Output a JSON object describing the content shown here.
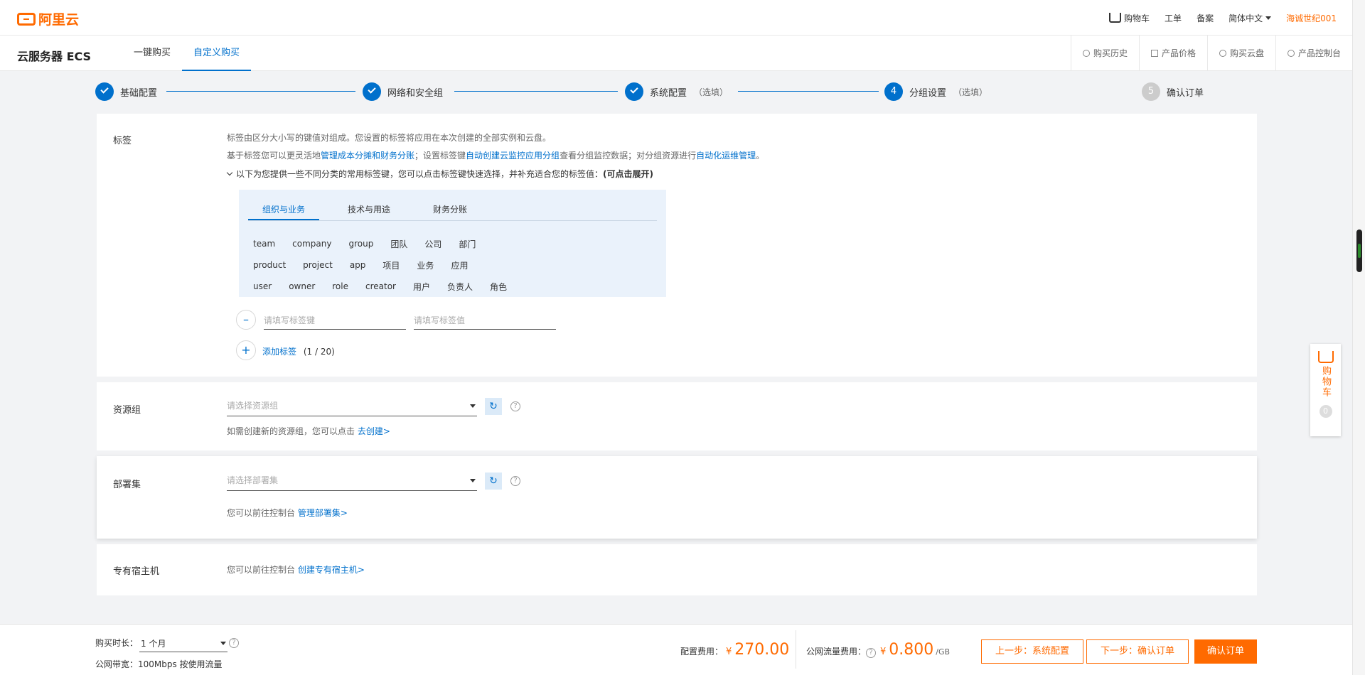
{
  "header": {
    "logo_text": "阿里云",
    "cart_label": "购物车",
    "ticket_label": "工单",
    "record_label": "备案",
    "language_label": "简体中文",
    "username": "海诚世纪001"
  },
  "subnav": {
    "product_title": "云服务器 ECS",
    "tabs": [
      "一键购买",
      "自定义购买"
    ],
    "links": [
      "购买历史",
      "产品价格",
      "购买云盘",
      "产品控制台"
    ]
  },
  "steps": [
    {
      "num": "",
      "label": "基础配置",
      "optional": ""
    },
    {
      "num": "",
      "label": "网络和安全组",
      "optional": ""
    },
    {
      "num": "",
      "label": "系统配置",
      "optional": "（选填）"
    },
    {
      "num": "4",
      "label": "分组设置",
      "optional": "（选填）"
    },
    {
      "num": "5",
      "label": "确认订单",
      "optional": ""
    }
  ],
  "tags": {
    "label": "标签",
    "desc1": "标签由区分大小写的键值对组成。您设置的标签将应用在本次创建的全部实例和云盘。",
    "desc2_prefix": "基于标签您可以更灵活地",
    "desc2_link1": "管理成本分摊和财务分账",
    "desc2_mid": "；设置标签键",
    "desc2_link2": "自动创建云监控应用分组",
    "desc2_mid2": "查看分组监控数据；对分组资源进行",
    "desc2_link3": "自动化运维管理",
    "desc2_end": "。",
    "expand_text": "以下为您提供一些不同分类的常用标签键，您可以点击标签键快速选择，并补充适合您的标签值：",
    "expand_bold": "(可点击展开)",
    "categories": [
      "组织与业务",
      "技术与用途",
      "财务分账"
    ],
    "rows": [
      [
        "team",
        "company",
        "group",
        "团队",
        "公司",
        "部门"
      ],
      [
        "product",
        "project",
        "app",
        "项目",
        "业务",
        "应用"
      ],
      [
        "user",
        "owner",
        "role",
        "creator",
        "用户",
        "负责人",
        "角色"
      ]
    ],
    "key_placeholder": "请填写标签键",
    "value_placeholder": "请填写标签值",
    "add_label": "添加标签",
    "add_count": "(1 / 20)"
  },
  "resource_group": {
    "label": "资源组",
    "placeholder": "请选择资源组",
    "hint": "如需创建新的资源组，您可以点击",
    "link": "去创建>"
  },
  "deploy_set": {
    "label": "部署集",
    "placeholder": "请选择部署集",
    "hint": "您可以前往控制台",
    "link": "管理部署集>"
  },
  "dedicated_host": {
    "label": "专有宿主机",
    "hint": "您可以前往控制台",
    "link": "创建专有宿主机>"
  },
  "footer": {
    "duration_label": "购买时长：",
    "duration_value": "1 个月",
    "bandwidth_text": "公网带宽：100Mbps 按使用流量",
    "config_fee_label": "配置费用：",
    "currency": "¥",
    "config_fee": "270.00",
    "traffic_fee_label": "公网流量费用：",
    "traffic_fee": "0.800",
    "traffic_unit": "/GB",
    "prev_button": "上一步：系统配置",
    "next_button": "下一步：确认订单",
    "confirm_button": "确认订单"
  },
  "float_cart": {
    "label": "购物车",
    "count": "0"
  },
  "colors": {
    "brand": "#ff6a00",
    "link": "#0070cc"
  }
}
